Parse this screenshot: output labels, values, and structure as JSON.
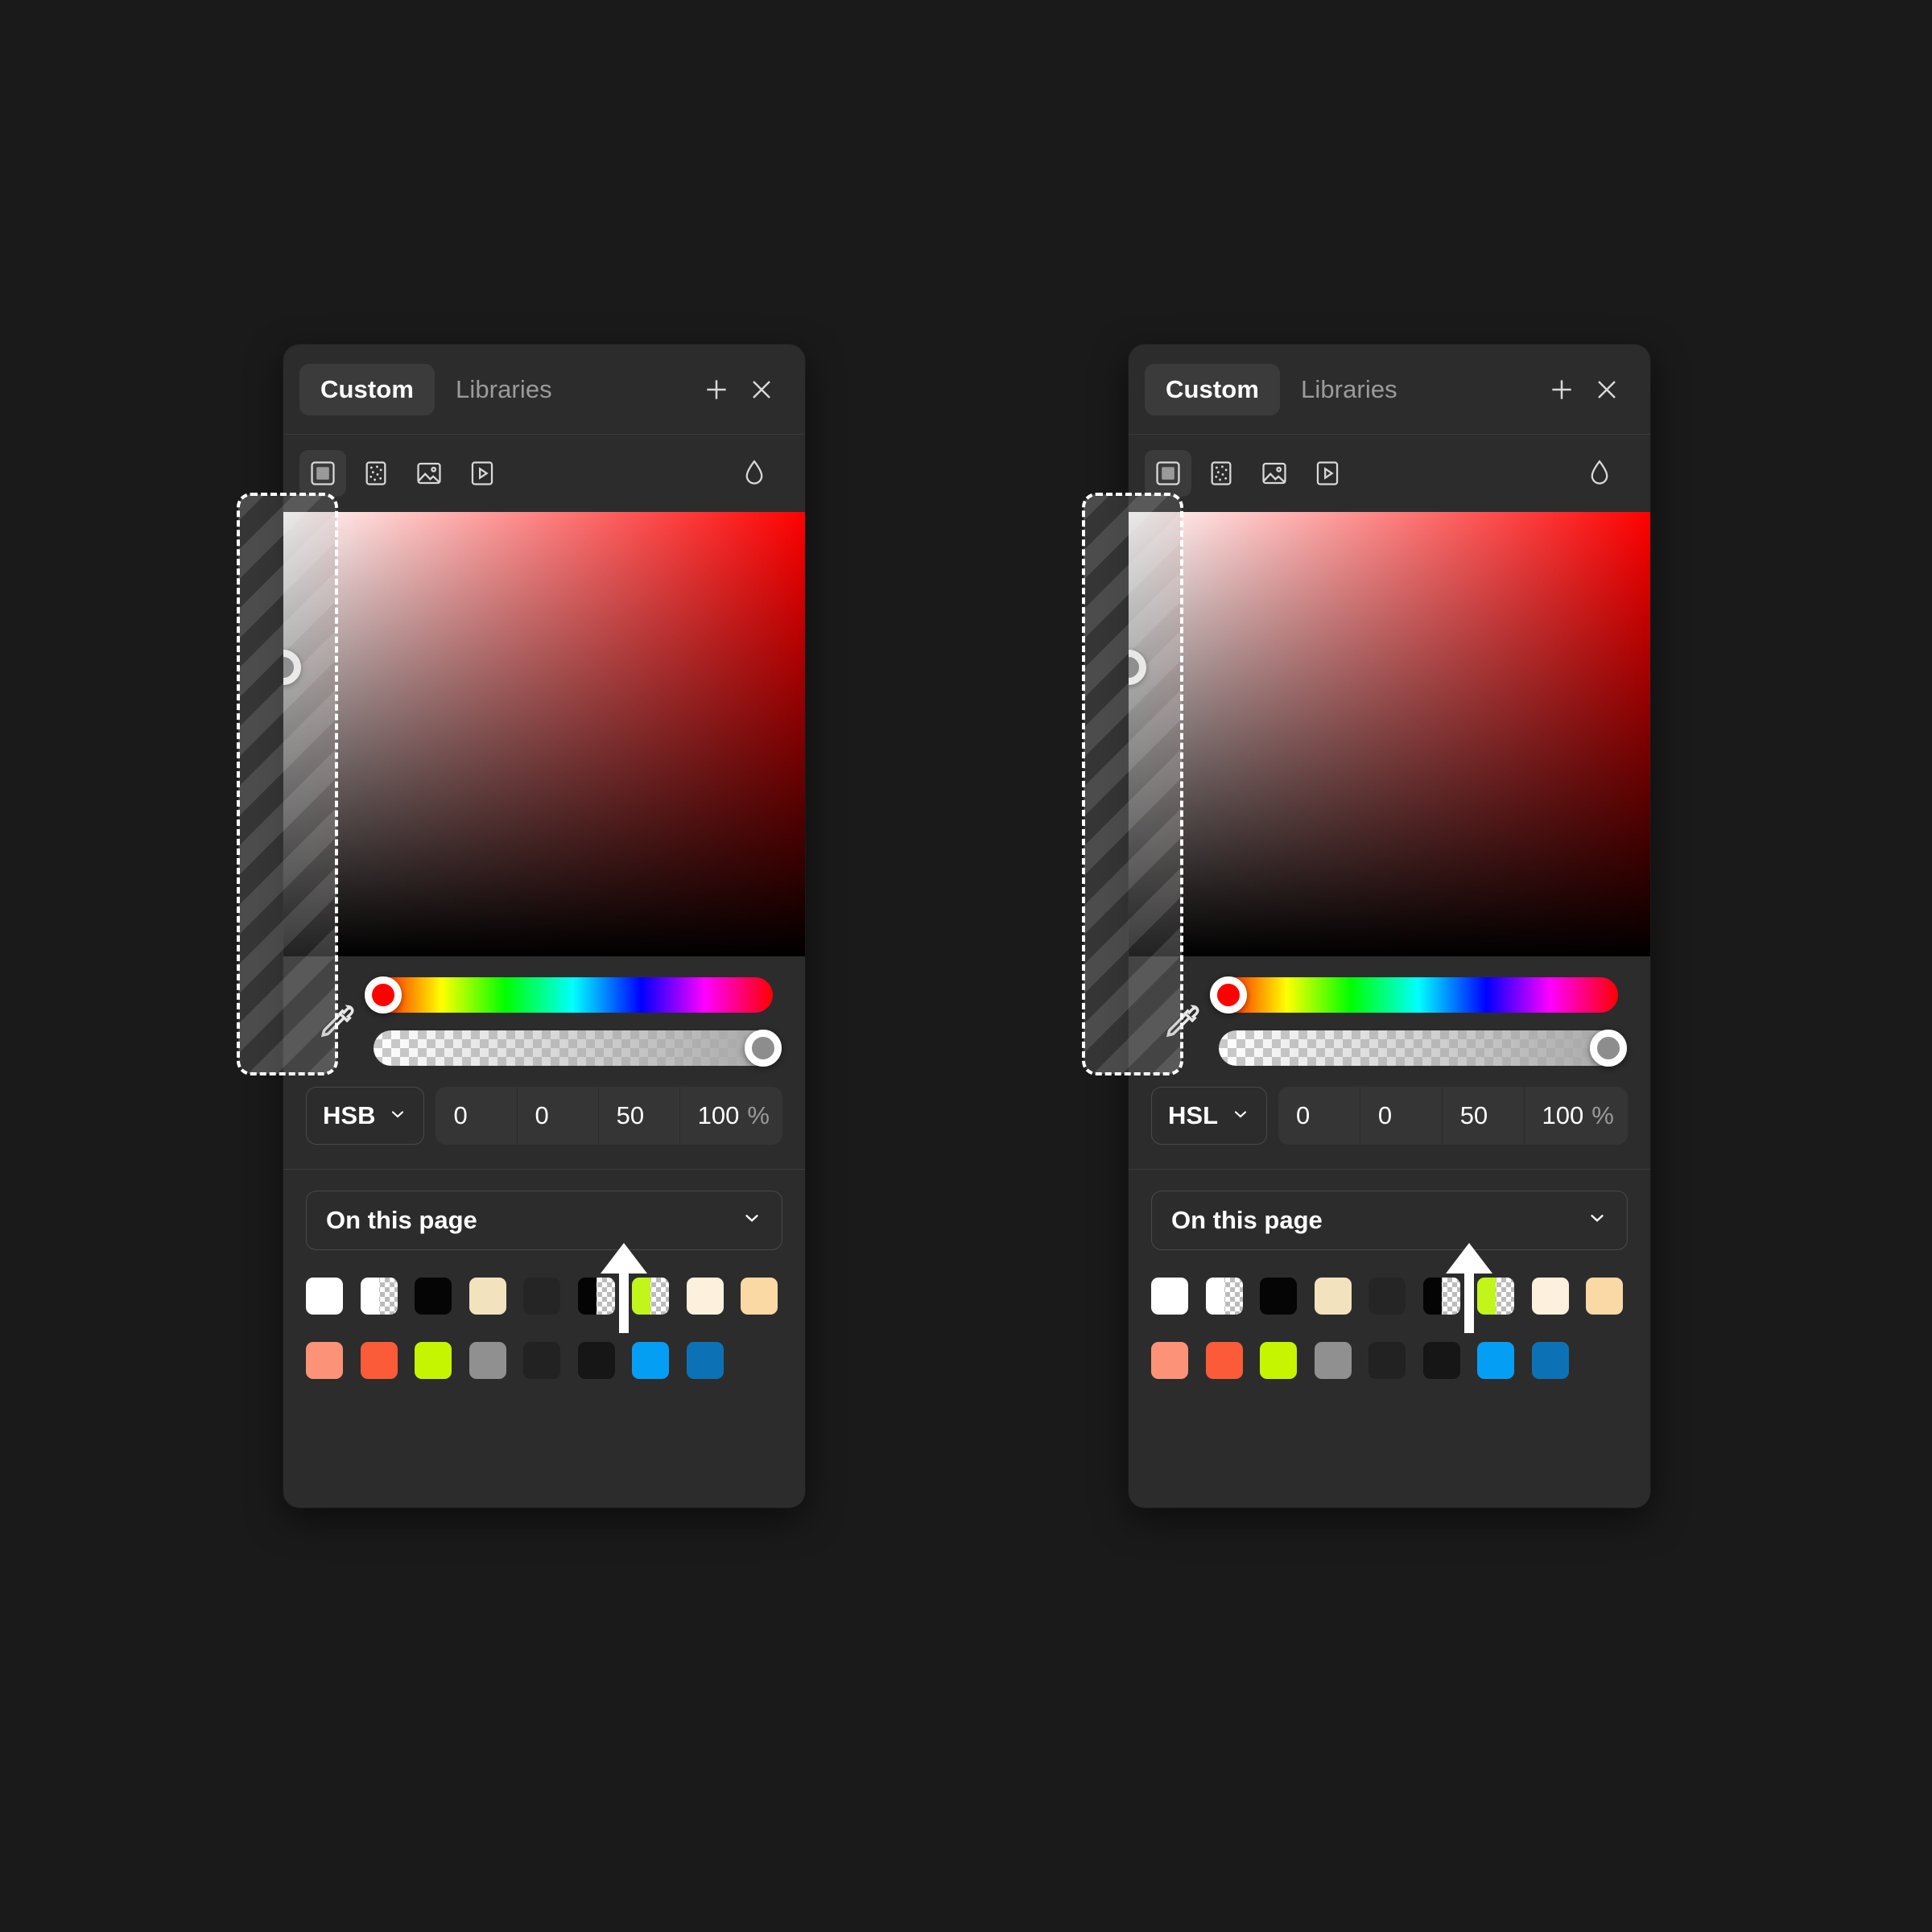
{
  "page": {
    "background": "#1a1a1a"
  },
  "panels": [
    {
      "id": "left",
      "header": {
        "tabs": [
          {
            "label": "Custom",
            "active": true
          },
          {
            "label": "Libraries",
            "active": false
          }
        ],
        "add_label": "+",
        "close_label": "×"
      },
      "toolbar": {
        "tools": [
          {
            "name": "solid-fill",
            "active": true
          },
          {
            "name": "noise-fill",
            "active": false
          },
          {
            "name": "image-fill",
            "active": false
          },
          {
            "name": "video-fill",
            "active": false
          }
        ],
        "blend_icon": "droplet-icon"
      },
      "color_field": {
        "base_hue_color": "#ff0000",
        "handle_x_pct": 0.0,
        "handle_y_pct": 35.0,
        "handle_fill": "#8d8d8d"
      },
      "sliders": {
        "eyedropper_icon": "eyedropper-icon",
        "hue": {
          "value_pct": 0,
          "knob_color": "#ff0000"
        },
        "alpha": {
          "value_pct": 100,
          "knob_color": "#8d8d8d"
        }
      },
      "values": {
        "model": "HSB",
        "fields": [
          "0",
          "0",
          "50",
          "100"
        ],
        "percent_sign": "%"
      },
      "palette": {
        "source_label": "On this page",
        "swatches_row1": [
          {
            "name": "white",
            "color": "#ffffff",
            "checker": false
          },
          {
            "name": "white-alpha",
            "color": "#ffffff",
            "checker": true
          },
          {
            "name": "black",
            "color": "#050505",
            "checker": false
          },
          {
            "name": "cream",
            "color": "#f2e2bd",
            "checker": false
          },
          {
            "name": "dark-gray",
            "color": "#252525",
            "checker": false
          },
          {
            "name": "black-alpha",
            "color": "#040404",
            "checker": true
          },
          {
            "name": "lime-alpha",
            "color": "#c2f51a",
            "checker": true
          },
          {
            "name": "off-white",
            "color": "#fdf0dc",
            "checker": false
          },
          {
            "name": "peach",
            "color": "#fad9a4",
            "checker": false
          }
        ],
        "swatches_row2": [
          {
            "name": "salmon",
            "color": "#fc9277",
            "checker": false
          },
          {
            "name": "orange-red",
            "color": "#fb5b38",
            "checker": false
          },
          {
            "name": "lime",
            "color": "#c6f500",
            "checker": false
          },
          {
            "name": "gray",
            "color": "#909090",
            "checker": false
          },
          {
            "name": "near-black-1",
            "color": "#222222",
            "checker": false
          },
          {
            "name": "near-black-2",
            "color": "#161616",
            "checker": false
          },
          {
            "name": "bright-blue",
            "color": "#059ef5",
            "checker": false
          },
          {
            "name": "deep-blue",
            "color": "#0c72b5",
            "checker": false
          }
        ]
      }
    },
    {
      "id": "right",
      "header": {
        "tabs": [
          {
            "label": "Custom",
            "active": true
          },
          {
            "label": "Libraries",
            "active": false
          }
        ],
        "add_label": "+",
        "close_label": "×"
      },
      "toolbar": {
        "tools": [
          {
            "name": "solid-fill",
            "active": true
          },
          {
            "name": "noise-fill",
            "active": false
          },
          {
            "name": "image-fill",
            "active": false
          },
          {
            "name": "video-fill",
            "active": false
          }
        ],
        "blend_icon": "droplet-icon"
      },
      "color_field": {
        "base_hue_color": "#ff0000",
        "handle_x_pct": 0.0,
        "handle_y_pct": 35.0,
        "handle_fill": "#8d8d8d"
      },
      "sliders": {
        "eyedropper_icon": "eyedropper-icon",
        "hue": {
          "value_pct": 0,
          "knob_color": "#ff0000"
        },
        "alpha": {
          "value_pct": 100,
          "knob_color": "#8d8d8d"
        }
      },
      "values": {
        "model": "HSL",
        "fields": [
          "0",
          "0",
          "50",
          "100"
        ],
        "percent_sign": "%"
      },
      "palette": {
        "source_label": "On this page",
        "swatches_row1": [
          {
            "name": "white",
            "color": "#ffffff",
            "checker": false
          },
          {
            "name": "white-alpha",
            "color": "#ffffff",
            "checker": true
          },
          {
            "name": "black",
            "color": "#050505",
            "checker": false
          },
          {
            "name": "cream",
            "color": "#f2e2bd",
            "checker": false
          },
          {
            "name": "dark-gray",
            "color": "#252525",
            "checker": false
          },
          {
            "name": "black-alpha",
            "color": "#040404",
            "checker": true
          },
          {
            "name": "lime-alpha",
            "color": "#c2f51a",
            "checker": true
          },
          {
            "name": "off-white",
            "color": "#fdf0dc",
            "checker": false
          },
          {
            "name": "peach",
            "color": "#fad9a4",
            "checker": false
          }
        ],
        "swatches_row2": [
          {
            "name": "salmon",
            "color": "#fc9277",
            "checker": false
          },
          {
            "name": "orange-red",
            "color": "#fb5b38",
            "checker": false
          },
          {
            "name": "lime",
            "color": "#c6f500",
            "checker": false
          },
          {
            "name": "gray",
            "color": "#909090",
            "checker": false
          },
          {
            "name": "near-black-1",
            "color": "#222222",
            "checker": false
          },
          {
            "name": "near-black-2",
            "color": "#161616",
            "checker": false
          },
          {
            "name": "bright-blue",
            "color": "#059ef5",
            "checker": false
          },
          {
            "name": "deep-blue",
            "color": "#0c72b5",
            "checker": false
          }
        ]
      }
    }
  ],
  "annotations": {
    "drag_ghosts": [
      {
        "name": "drag-ghost-left",
        "stripe_color": "#ffffff",
        "border_style": "dashed"
      },
      {
        "name": "drag-ghost-right",
        "stripe_color": "#ffffff",
        "border_style": "dashed"
      }
    ],
    "arrows": [
      {
        "name": "arrow-left",
        "direction": "up",
        "color": "#ffffff",
        "points_to": "50"
      },
      {
        "name": "arrow-right",
        "direction": "up",
        "color": "#ffffff",
        "points_to": "50"
      }
    ]
  }
}
